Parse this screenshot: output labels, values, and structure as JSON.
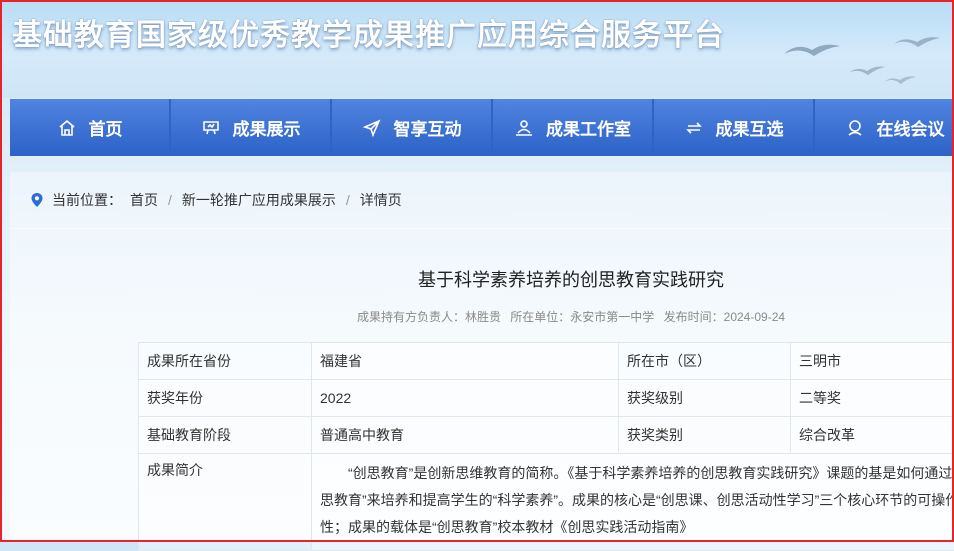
{
  "site_title": "基础教育国家级优秀教学成果推广应用综合服务平台",
  "nav": {
    "items": [
      {
        "label": "首页",
        "icon": "home-icon"
      },
      {
        "label": "成果展示",
        "icon": "presentation-board-icon"
      },
      {
        "label": "智享互动",
        "icon": "send-arrow-icon"
      },
      {
        "label": "成果工作室",
        "icon": "person-studio-icon"
      },
      {
        "label": "成果互选",
        "icon": "swap-arrows-icon"
      },
      {
        "label": "在线会议",
        "icon": "meeting-icon"
      }
    ]
  },
  "breadcrumb": {
    "prefix": "当前位置：",
    "items": [
      "首页",
      "新一轮推广应用成果展示",
      "详情页"
    ],
    "separator": "/"
  },
  "article": {
    "title": "基于科学素养培养的创思教育实践研究",
    "meta": {
      "holder": "成果持有方负责人：林胜贵",
      "unit": "所在单位：永安市第一中学",
      "published": "发布时间：2024-09-24"
    }
  },
  "info_table": {
    "rows": [
      {
        "label1": "成果所在省份",
        "value1": "福建省",
        "label2": "所在市（区）",
        "value2": "三明市"
      },
      {
        "label1": "获奖年份",
        "value1": "2022",
        "label2": "获奖级别",
        "value2": "二等奖"
      },
      {
        "label1": "基础教育阶段",
        "value1": "普通高中教育",
        "label2": "获奖类别",
        "value2": "综合改革"
      }
    ],
    "summary_label": "成果简介",
    "summary_text": "“创思教育”是创新思维教育的简称。《基于科学素养培养的创思教育实践研究》课题的基是如何通过 “创思教育”来培养和提高学生的“科学素养”。成果的核心是“创思课、创思活动性学习”三个核心环节的可操作性；成果的载体是“创思教育”校本教材《创思实践活动指南》"
  },
  "colors": {
    "frame": "#e8232a",
    "nav_bg": "#2d62c8",
    "pin": "#2a6fd6"
  }
}
